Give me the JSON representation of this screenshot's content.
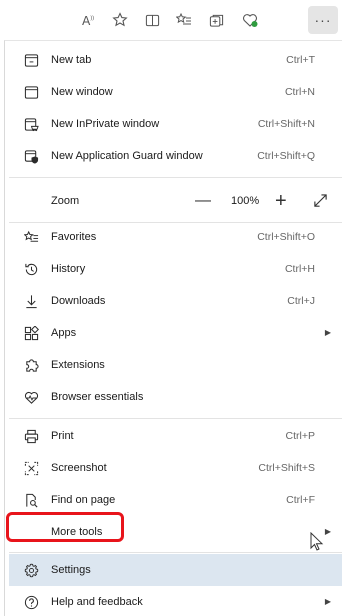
{
  "menu": {
    "items": [
      {
        "label": "New tab",
        "shortcut": "Ctrl+T"
      },
      {
        "label": "New window",
        "shortcut": "Ctrl+N"
      },
      {
        "label": "New InPrivate window",
        "shortcut": "Ctrl+Shift+N"
      },
      {
        "label": "New Application Guard window",
        "shortcut": "Ctrl+Shift+Q"
      }
    ],
    "zoom": {
      "label": "Zoom",
      "minus": "—",
      "value": "100%",
      "plus": "+"
    },
    "group2": [
      {
        "label": "Favorites",
        "shortcut": "Ctrl+Shift+O"
      },
      {
        "label": "History",
        "shortcut": "Ctrl+H"
      },
      {
        "label": "Downloads",
        "shortcut": "Ctrl+J"
      },
      {
        "label": "Apps",
        "shortcut": ""
      },
      {
        "label": "Extensions",
        "shortcut": ""
      },
      {
        "label": "Browser essentials",
        "shortcut": ""
      }
    ],
    "group3": [
      {
        "label": "Print",
        "shortcut": "Ctrl+P"
      },
      {
        "label": "Screenshot",
        "shortcut": "Ctrl+Shift+S"
      },
      {
        "label": "Find on page",
        "shortcut": "Ctrl+F"
      },
      {
        "label": "More tools",
        "shortcut": ""
      }
    ],
    "group4": [
      {
        "label": "Settings",
        "shortcut": ""
      },
      {
        "label": "Help and feedback",
        "shortcut": ""
      }
    ]
  },
  "colors": {
    "highlight": "#e8141b",
    "hover": "#dce6f0"
  }
}
